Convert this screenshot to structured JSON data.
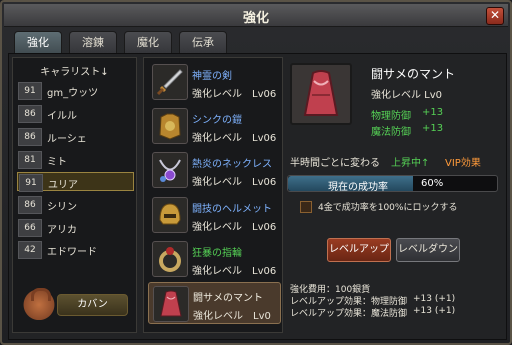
{
  "window": {
    "title": "強化",
    "close_label": "✕"
  },
  "tabs": [
    {
      "label": "強化"
    },
    {
      "label": "溶錬"
    },
    {
      "label": "魔化"
    },
    {
      "label": "伝承"
    }
  ],
  "characters": {
    "header": "キャラリスト↓",
    "items": [
      {
        "level": "91",
        "name": "gm_ウッツ"
      },
      {
        "level": "86",
        "name": "イルル"
      },
      {
        "level": "86",
        "name": "ルーシェ"
      },
      {
        "level": "81",
        "name": "ミト"
      },
      {
        "level": "91",
        "name": "ユリア"
      },
      {
        "level": "86",
        "name": "シリン"
      },
      {
        "level": "66",
        "name": "アリカ"
      },
      {
        "level": "42",
        "name": "エドワード"
      }
    ],
    "bag_label": "カバン"
  },
  "items": [
    {
      "name": "神霊の剣",
      "level_text": "強化レベル　Lv06",
      "icon": "sword-icon"
    },
    {
      "name": "シンクの鎧",
      "level_text": "強化レベル　Lv06",
      "icon": "armor-icon"
    },
    {
      "name": "熱炎のネックレス",
      "level_text": "強化レベル　Lv06",
      "icon": "necklace-icon"
    },
    {
      "name": "闘技のヘルメット",
      "level_text": "強化レベル　Lv06",
      "icon": "helmet-icon"
    },
    {
      "name": "狂暴の指輪",
      "level_text": "強化レベル　Lv06",
      "icon": "ring-icon"
    },
    {
      "name": "闘サメのマント",
      "level_text": "強化レベル　Lv0",
      "icon": "cloak-icon"
    }
  ],
  "detail": {
    "name": "闘サメのマント",
    "level_text": "強化レベル Lv0",
    "stats": [
      {
        "label": "物理防御",
        "value": "+13"
      },
      {
        "label": "魔法防御",
        "value": "+13"
      }
    ],
    "half_hour_text": "半時間ごとに変わる",
    "rise_text": "上昇中↑",
    "vip_text": "VIP効果",
    "rate_label": "現在の成功率",
    "rate_value": "60%",
    "rate_fraction": 0.6,
    "lock_label": "4金で成功率を100%にロックする",
    "level_up_label": "レベルアップ",
    "level_down_label": "レベルダウン",
    "cost_text": "強化費用：100銀貨",
    "effects": [
      {
        "label": "レベルアップ効果：物理防御",
        "value": "+13 (+1)"
      },
      {
        "label": "レベルアップ効果：魔法防御",
        "value": "+13 (+1)"
      }
    ]
  },
  "colors": {
    "accent_gold": "#9a8440",
    "stat_green": "#55d055",
    "vip_orange": "#ff9a3a",
    "item_blue": "#7fb3ff"
  }
}
